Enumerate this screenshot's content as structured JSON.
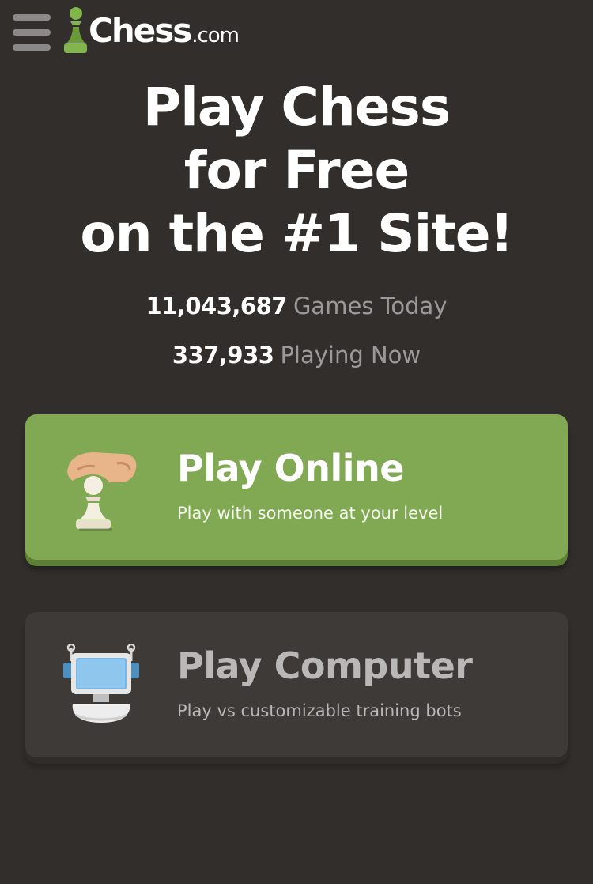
{
  "header": {
    "logo_text": "Chess",
    "logo_suffix": ".com",
    "menu_icon": "hamburger-menu-icon",
    "brand_color": "#81b64c"
  },
  "hero": {
    "line1": "Play Chess",
    "line2": "for Free",
    "line3": "on the #1 Site!"
  },
  "stats": [
    {
      "number": "11,043,687",
      "label": "Games Today"
    },
    {
      "number": "337,933",
      "label": "Playing Now"
    }
  ],
  "cards": {
    "online": {
      "title": "Play Online",
      "subtitle": "Play with someone at your level",
      "icon": "hand-moving-pawn-icon",
      "color": "#81a954"
    },
    "computer": {
      "title": "Play Computer",
      "subtitle": "Play vs customizable training bots",
      "icon": "robot-computer-icon",
      "color": "#3d3a37"
    }
  }
}
